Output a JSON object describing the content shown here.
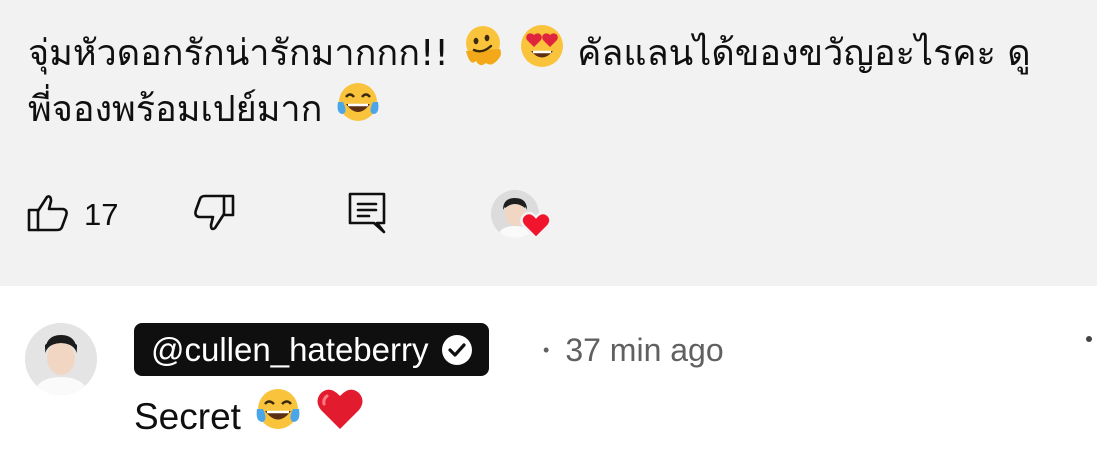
{
  "comment": {
    "line1_a": "จุ่มหัวดอกรักน่ารักมากกก!!",
    "line1_b": "คัลแลนได้ของขวัญอะไรคะ ดู",
    "line2": "พี่จองพร้อมเปย์มาก",
    "emojis": [
      "melting-face-emoji",
      "heart-eyes-emoji",
      "tears-of-joy-emoji"
    ]
  },
  "actions": {
    "like_count": "17",
    "icons": [
      "thumbs-up-icon",
      "thumbs-down-icon",
      "reply-icon",
      "creator-heart-icon"
    ]
  },
  "reply": {
    "handle": "@cullen_hateberry",
    "time": "37 min ago",
    "separator": "•",
    "text": "Secret",
    "emojis": [
      "tears-of-joy-emoji",
      "red-heart-emoji"
    ]
  },
  "colors": {
    "background_top": "#f2f2f2",
    "pill": "#0f0f0f",
    "heart": "#f0142c",
    "meta": "#606060"
  }
}
